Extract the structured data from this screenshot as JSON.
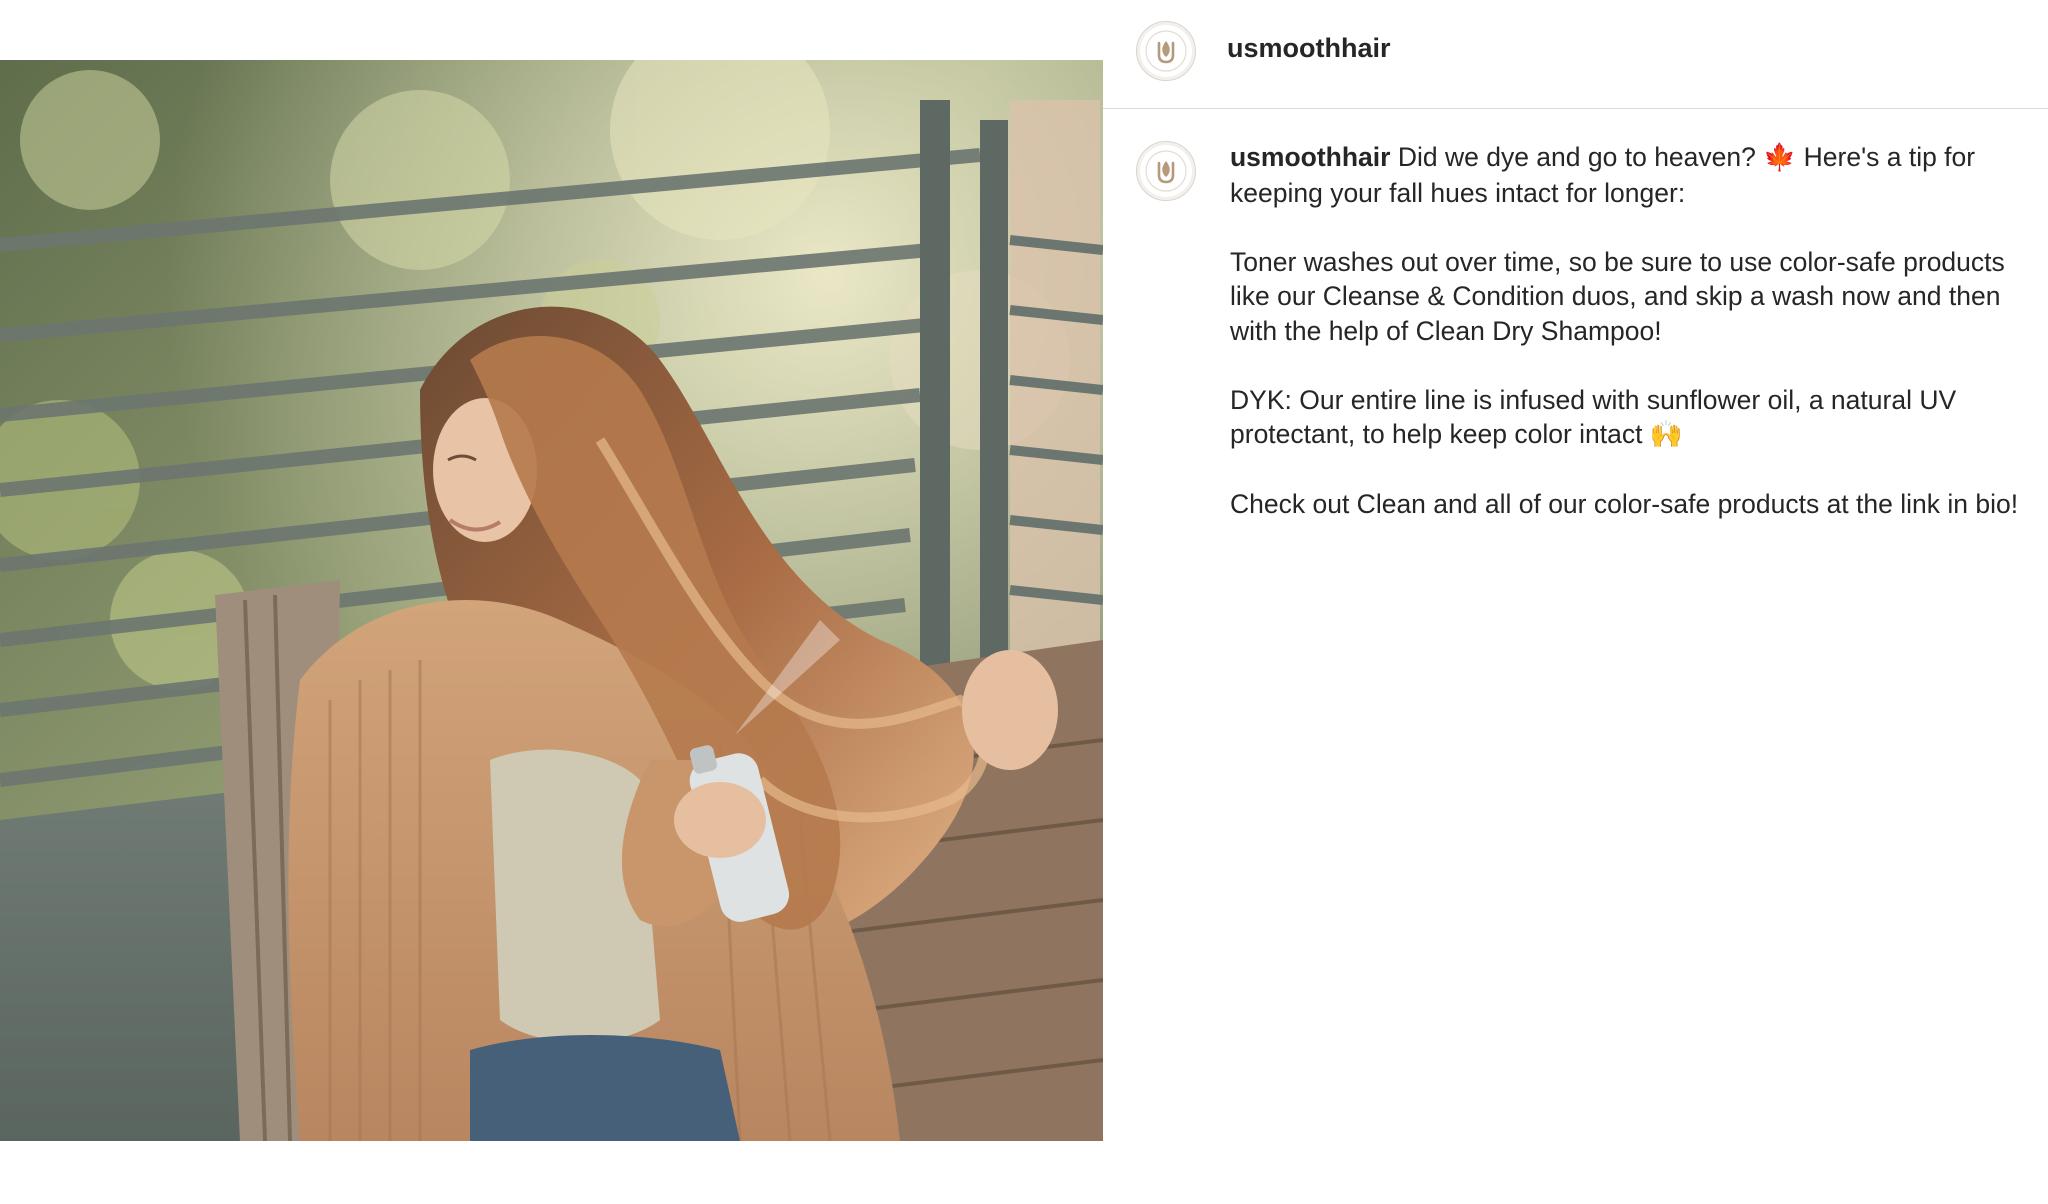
{
  "post": {
    "username": "usmoothhair",
    "avatar_icon": "usmooth-logo-icon",
    "image_icon": "post-photo-woman-spraying-dry-shampoo",
    "caption": {
      "author": "usmoothhair",
      "line1_text": "Did we dye and go to heaven?",
      "leaf_emoji": "🍁",
      "line1_rest": "Here's a tip for keeping your fall hues intact for longer:",
      "paragraph2": "Toner washes out over time, so be sure to use color-safe products like our Cleanse & Condition duos, and skip a wash now and then with the help of Clean Dry Shampoo!",
      "paragraph3_text": "DYK: Our entire line is infused with sunflower oil, a natural UV protectant, to help keep color intact",
      "hands_emoji": "🙌",
      "paragraph4": "Check out Clean and all of our color-safe products at the link in bio!"
    }
  },
  "colors": {
    "text": "#262626",
    "divider": "#dbdbdb",
    "logo": "#b59a7c"
  }
}
